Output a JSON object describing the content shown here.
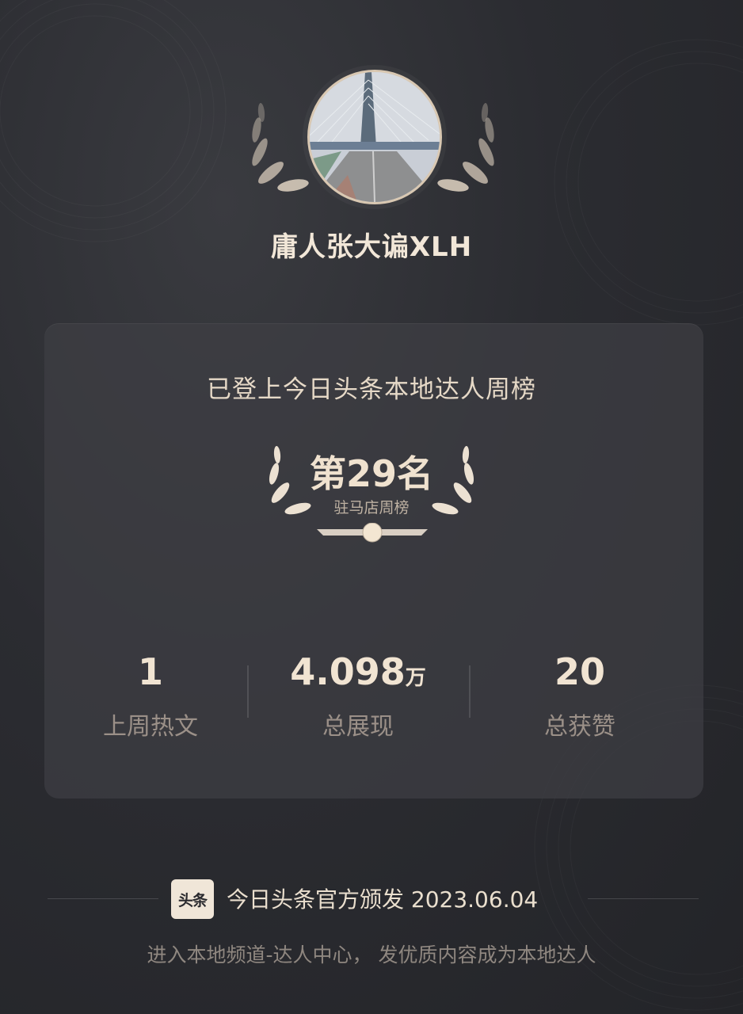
{
  "profile": {
    "username": "庸人张大谝XLH"
  },
  "card": {
    "title": "已登上今日头条本地达人周榜",
    "rank": "第29名",
    "rank_scope": "驻马店周榜"
  },
  "stats": [
    {
      "value": "1",
      "unit": "",
      "label": "上周热文"
    },
    {
      "value": "4.098",
      "unit": "万",
      "label": "总展现"
    },
    {
      "value": "20",
      "unit": "",
      "label": "总获赞"
    }
  ],
  "footer": {
    "logo_text": "头条",
    "issued_by": "今日头条官方颁发 2023.06.04",
    "hint": "进入本地频道-达人中心， 发优质内容成为本地达人"
  },
  "colors": {
    "accent": "#e9dccb",
    "background": "#2b2c31",
    "card": "#3e3f44"
  }
}
